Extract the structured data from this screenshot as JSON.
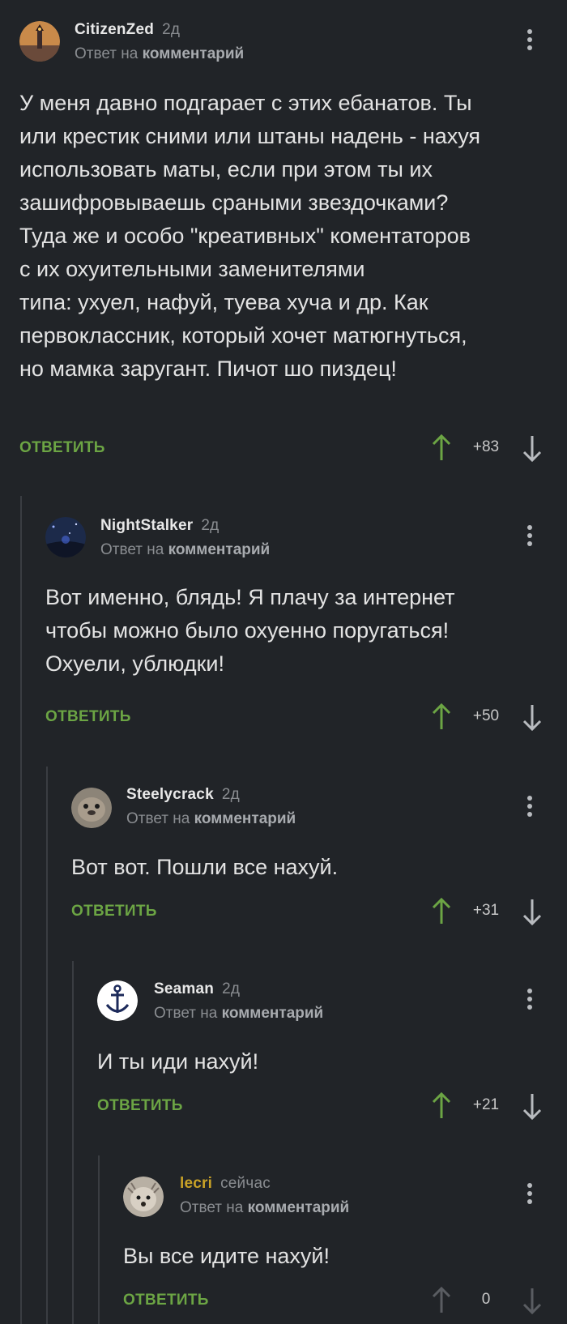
{
  "comments": [
    {
      "author": "CitizenZed",
      "time": "2д",
      "reply_prefix": "Ответ на",
      "reply_link": "комментарий",
      "text": "У меня давно подгарает с этих ебанатов. Ты\nили крестик сними или штаны надень - нахуя\nиспользовать маты, если при этом ты их\nзашифровываешь сраными звездочками?\nТуда же и особо \"креативных\" коментаторов\nс их охуительными заменителями\nтипа: ухуел, нафуй, туева хуча и др. Как\nпервоклассник, который хочет матюгнуться,\nно мамка заругант. Пичот шо пиздец!",
      "reply_label": "ОТВЕТИТЬ",
      "score": "+83"
    },
    {
      "author": "NightStalker",
      "time": "2д",
      "reply_prefix": "Ответ на",
      "reply_link": "комментарий",
      "text": "Вот именно, блядь! Я плачу за интернет\nчтобы можно было охуенно поругаться!\nОхуели, ублюдки!",
      "reply_label": "ОТВЕТИТЬ",
      "score": "+50"
    },
    {
      "author": "Steelycrack",
      "time": "2д",
      "reply_prefix": "Ответ на",
      "reply_link": "комментарий",
      "text": "Вот вот. Пошли все нахуй.",
      "reply_label": "ОТВЕТИТЬ",
      "score": "+31"
    },
    {
      "author": "Seaman",
      "time": "2д",
      "reply_prefix": "Ответ на",
      "reply_link": "комментарий",
      "text": "И ты иди нахуй!",
      "reply_label": "ОТВЕТИТЬ",
      "score": "+21"
    },
    {
      "author": "lecri",
      "time": "сейчас",
      "reply_prefix": "Ответ на",
      "reply_link": "комментарий",
      "text": "Вы все идите нахуй!",
      "reply_label": "ОТВЕТИТЬ",
      "score": "0"
    }
  ],
  "colors": {
    "background": "#212428",
    "reply_green": "#6ca544",
    "upvote_green": "#6ca544",
    "own_author": "#c9a227",
    "thread_line": "#3a3d42"
  },
  "icons": {
    "upvote": "arrow-up-icon",
    "downvote": "arrow-down-icon",
    "menu": "more-vertical-icon"
  }
}
